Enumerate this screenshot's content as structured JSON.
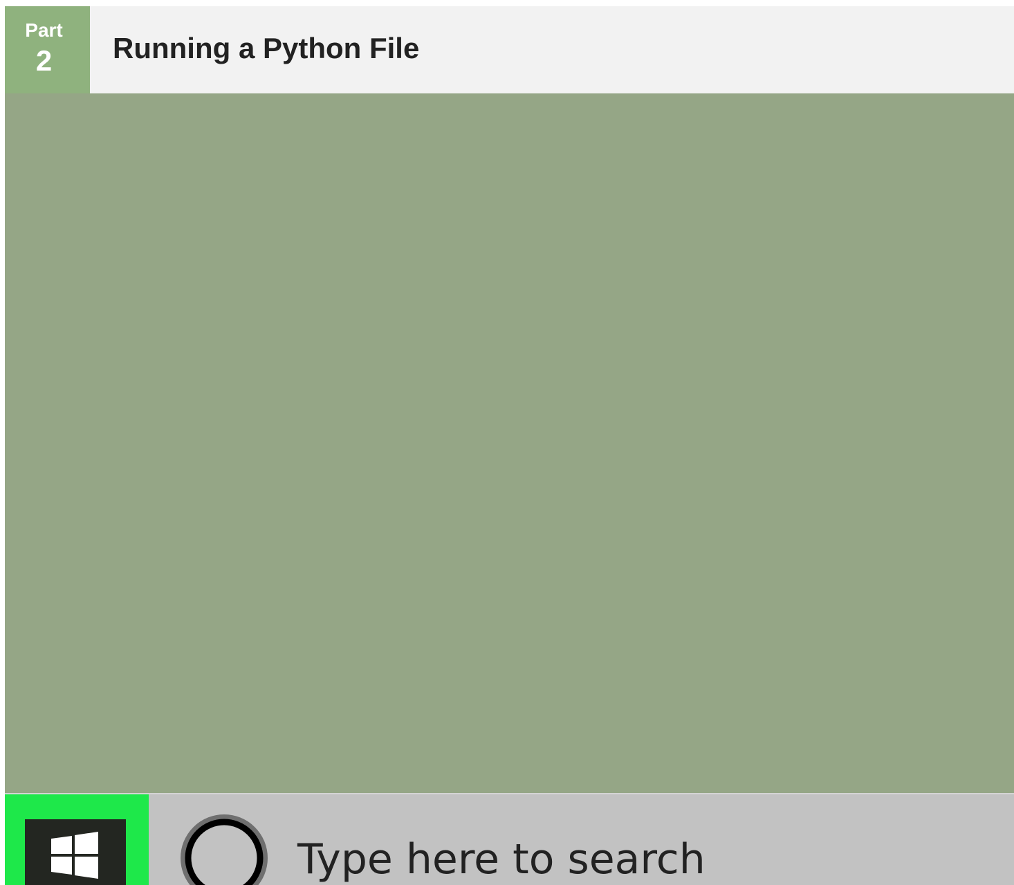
{
  "header": {
    "part_label": "Part",
    "part_number": "2",
    "title": "Running a Python File"
  },
  "taskbar": {
    "start_icon": "windows-logo-icon",
    "search_icon": "cortana-ring-icon",
    "search_placeholder": "Type here to search"
  },
  "colors": {
    "badge": "#8fb27e",
    "header_bg": "#f2f2f2",
    "desktop": "#95a686",
    "taskbar": "#c2c2c2",
    "start_highlight": "#1ee84a",
    "start_button": "#232621"
  }
}
